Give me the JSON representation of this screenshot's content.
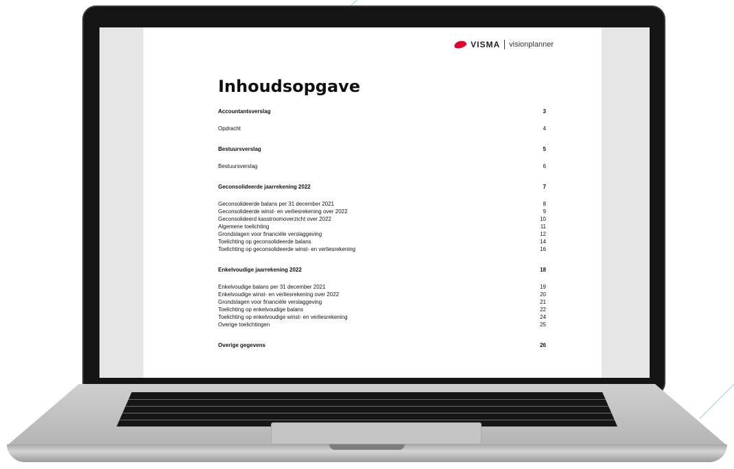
{
  "brand": {
    "name": "VISMA",
    "sub": "visionplanner",
    "accent": "#e4002b"
  },
  "document": {
    "title": "Inhoudsopgave",
    "sections": [
      {
        "label": "Accountantsverslag",
        "page": "3",
        "items": [
          {
            "label": "Opdracht",
            "page": "4"
          }
        ]
      },
      {
        "label": "Bestuursverslag",
        "page": "5",
        "items": [
          {
            "label": "Bestuursverslag",
            "page": "6"
          }
        ]
      },
      {
        "label": "Geconsolideerde jaarrekening 2022",
        "page": "7",
        "items": [
          {
            "label": "Geconsolideerde balans per 31 december 2021",
            "page": "8"
          },
          {
            "label": "Geconsolideerde winst- en verliesrekening over 2022",
            "page": "9"
          },
          {
            "label": "Geconsolideerd kasstroomoverzicht over 2022",
            "page": "10"
          },
          {
            "label": "Algemene toelichting",
            "page": "11"
          },
          {
            "label": "Grondslagen voor financiële verslaggeving",
            "page": "12"
          },
          {
            "label": "Toelichting op geconsolideerde balans",
            "page": "14"
          },
          {
            "label": "Toelichting op geconsolideerde winst- en verliesrekening",
            "page": "16"
          }
        ]
      },
      {
        "label": "Enkelvoudige jaarrekening 2022",
        "page": "18",
        "items": [
          {
            "label": "Enkelvoudige balans per 31 december 2021",
            "page": "19"
          },
          {
            "label": "Enkelvoudige winst- en verliesrekening over 2022",
            "page": "20"
          },
          {
            "label": "Grondslagen voor financiële verslaggeving",
            "page": "21"
          },
          {
            "label": "Toelichting op enkelvoudige balans",
            "page": "22"
          },
          {
            "label": "Toelichting op enkelvoudige winst- en verliesrekening",
            "page": "24"
          },
          {
            "label": "Overige toelichtingen",
            "page": "25"
          }
        ]
      },
      {
        "label": "Overige gegevens",
        "page": "26",
        "items": []
      }
    ]
  }
}
